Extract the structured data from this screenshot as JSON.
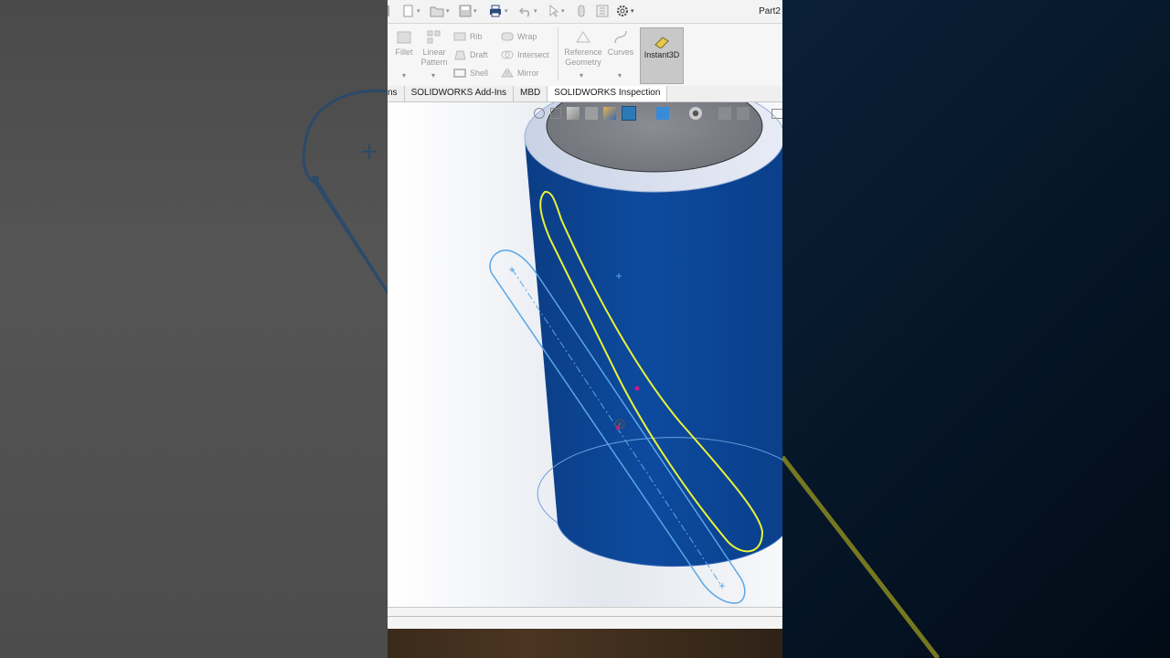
{
  "window": {
    "doc_title": "Part2"
  },
  "ribbon": {
    "fillet": "Fillet",
    "linear_pattern_1": "Linear",
    "linear_pattern_2": "Pattern",
    "rib": "Rib",
    "draft": "Draft",
    "shell": "Shell",
    "wrap": "Wrap",
    "intersect": "Intersect",
    "mirror": "Mirror",
    "reference_geometry_1": "Reference",
    "reference_geometry_2": "Geometry",
    "curves": "Curves",
    "instant3d": "Instant3D"
  },
  "tabs": [
    {
      "label": "ns"
    },
    {
      "label": "SOLIDWORKS Add-Ins"
    },
    {
      "label": "MBD"
    },
    {
      "label": "SOLIDWORKS Inspection"
    }
  ],
  "colors": {
    "cylinder": "#0a4a9a",
    "sketch_highlight": "#e8f23a",
    "sketch_line": "#5aa6e6",
    "point": "#d4148c"
  },
  "icons": {
    "new": "new-document-icon",
    "open": "open-folder-icon",
    "save": "save-icon",
    "print": "print-icon",
    "undo": "undo-icon",
    "select": "select-arrow-icon",
    "rebuild": "rebuild-icon",
    "options": "gear-icon"
  }
}
